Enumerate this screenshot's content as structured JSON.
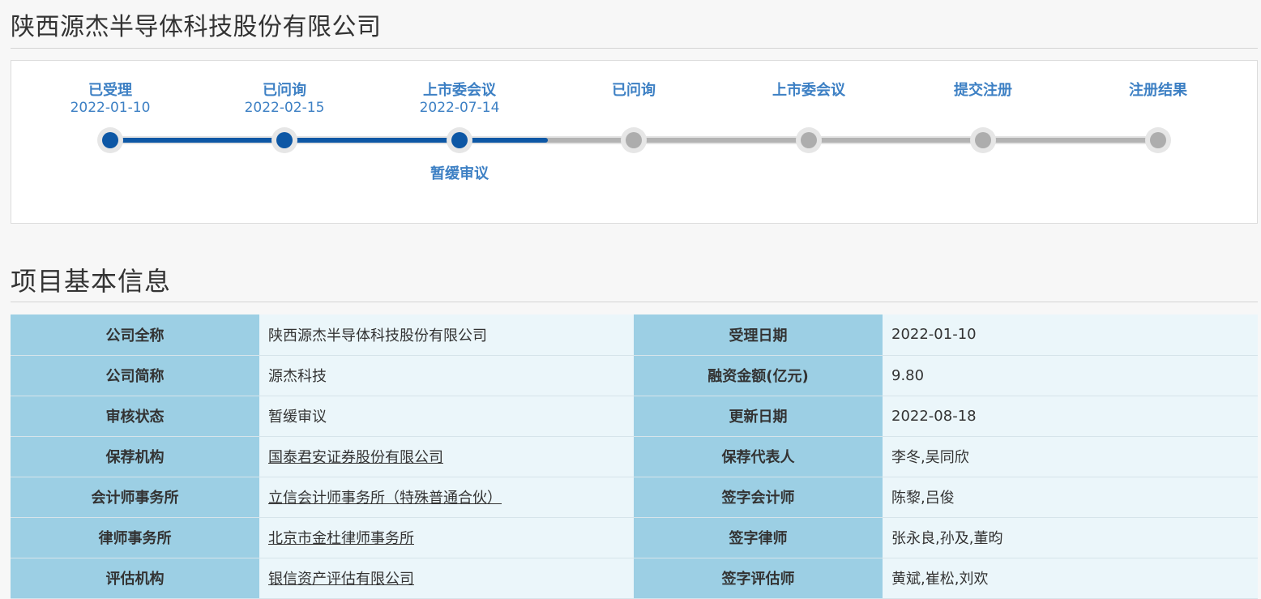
{
  "company": {
    "full_name": "陕西源杰半导体科技股份有限公司"
  },
  "progress": {
    "completed_steps": 3,
    "steps": [
      {
        "label": "已受理",
        "date": "2022-01-10",
        "note": ""
      },
      {
        "label": "已问询",
        "date": "2022-02-15",
        "note": ""
      },
      {
        "label": "上市委会议",
        "date": "2022-07-14",
        "note": "暂缓审议"
      },
      {
        "label": "已问询",
        "date": "",
        "note": ""
      },
      {
        "label": "上市委会议",
        "date": "",
        "note": ""
      },
      {
        "label": "提交注册",
        "date": "",
        "note": ""
      },
      {
        "label": "注册结果",
        "date": "",
        "note": ""
      }
    ],
    "colors": {
      "done": "#0d57a5",
      "pending": "#adadad",
      "label": "#3d80c4"
    }
  },
  "section": {
    "title": "项目基本信息"
  },
  "info": {
    "rows": [
      {
        "k1": "公司全称",
        "v1": "陕西源杰半导体科技股份有限公司",
        "k2": "受理日期",
        "v2": "2022-01-10"
      },
      {
        "k1": "公司简称",
        "v1": "源杰科技",
        "k2": "融资金额(亿元)",
        "v2": "9.80"
      },
      {
        "k1": "审核状态",
        "v1": "暂缓审议",
        "k2": "更新日期",
        "v2": "2022-08-18"
      },
      {
        "k1": "保荐机构",
        "v1": "国泰君安证券股份有限公司",
        "k2": "保荐代表人",
        "v2": "李冬,吴同欣"
      },
      {
        "k1": "会计师事务所",
        "v1": "立信会计师事务所（特殊普通合伙）",
        "k2": "签字会计师",
        "v2": "陈黎,吕俊"
      },
      {
        "k1": "律师事务所",
        "v1": "北京市金杜律师事务所",
        "k2": "签字律师",
        "v2": "张永良,孙及,董昀"
      },
      {
        "k1": "评估机构",
        "v1": "银信资产评估有限公司",
        "k2": "签字评估师",
        "v2": "黄斌,崔松,刘欢"
      }
    ],
    "colors": {
      "key_bg": "#9ccfe4",
      "value_bg": "#ebf6fa"
    }
  }
}
